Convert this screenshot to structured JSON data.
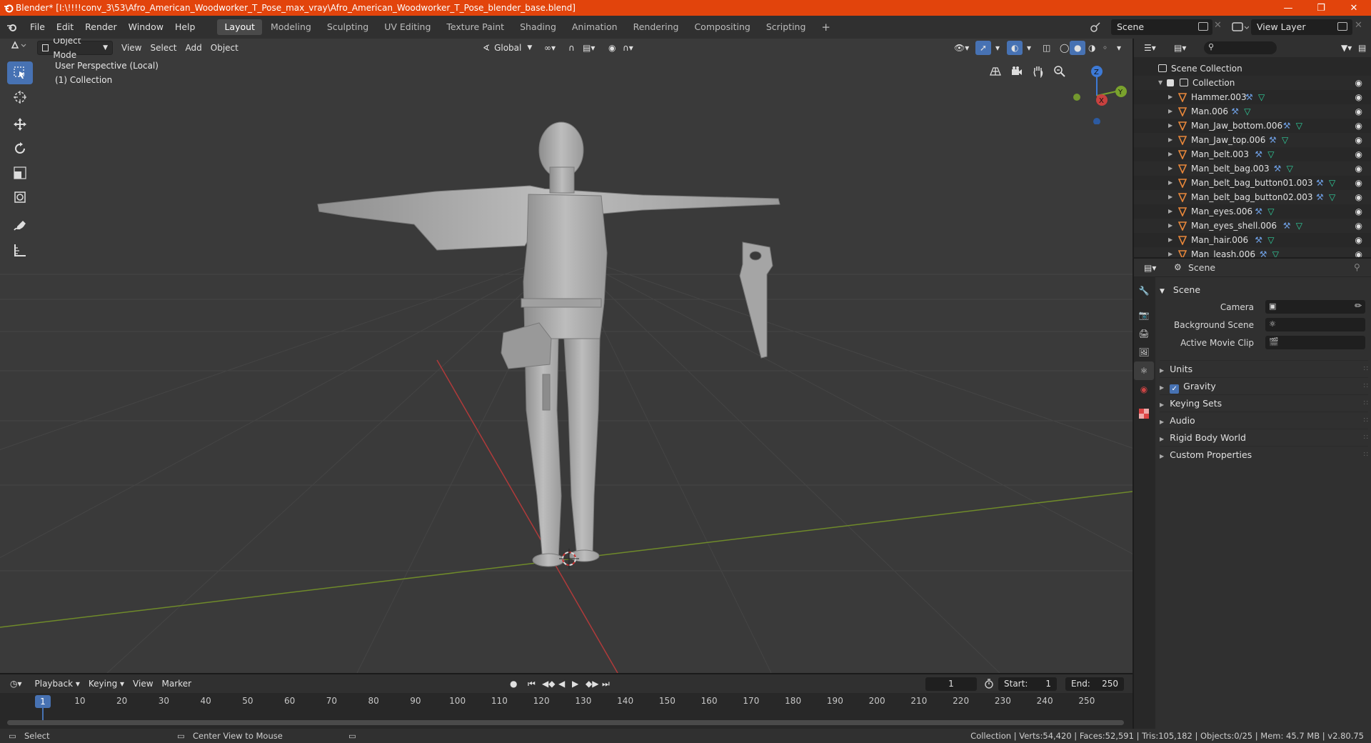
{
  "window": {
    "title": "Blender* [I:\\!!!!conv_3\\53\\Afro_American_Woodworker_T_Pose_max_vray\\Afro_American_Woodworker_T_Pose_blender_base.blend]",
    "controls": [
      "minimize",
      "maximize",
      "close"
    ]
  },
  "menu": {
    "items": [
      "File",
      "Edit",
      "Render",
      "Window",
      "Help"
    ]
  },
  "workspaces": [
    "Layout",
    "Modeling",
    "Sculpting",
    "UV Editing",
    "Texture Paint",
    "Shading",
    "Animation",
    "Rendering",
    "Compositing",
    "Scripting"
  ],
  "active_workspace": "Layout",
  "scene_selector": "Scene",
  "view_layer_selector": "View Layer",
  "viewport": {
    "mode": "Object Mode",
    "menus": [
      "View",
      "Select",
      "Add",
      "Object"
    ],
    "transform_orientation": "Global",
    "info_line1": "User Perspective (Local)",
    "info_line2": "(1) Collection",
    "gizmo": {
      "z": "Z",
      "y": "Y",
      "x": "X"
    }
  },
  "timeline": {
    "menus": [
      "Playback",
      "Keying",
      "View",
      "Marker"
    ],
    "current_frame": "1",
    "start_label": "Start:",
    "start": "1",
    "end_label": "End:",
    "end": "250",
    "ticks": [
      "10",
      "20",
      "30",
      "40",
      "50",
      "60",
      "70",
      "80",
      "90",
      "100",
      "110",
      "120",
      "130",
      "140",
      "150",
      "160",
      "170",
      "180",
      "190",
      "200",
      "210",
      "220",
      "230",
      "240",
      "250"
    ],
    "playhead": "1"
  },
  "outliner": {
    "root": "Scene Collection",
    "collection": "Collection",
    "objects": [
      {
        "name": "Hammer.003"
      },
      {
        "name": "Man.006"
      },
      {
        "name": "Man_Jaw_bottom.006"
      },
      {
        "name": "Man_Jaw_top.006"
      },
      {
        "name": "Man_belt.003"
      },
      {
        "name": "Man_belt_bag.003"
      },
      {
        "name": "Man_belt_bag_button01.003"
      },
      {
        "name": "Man_belt_bag_button02.003"
      },
      {
        "name": "Man_eyes.006"
      },
      {
        "name": "Man_eyes_shell.006"
      },
      {
        "name": "Man_hair.006"
      },
      {
        "name": "Man_leash.006"
      }
    ]
  },
  "properties": {
    "context": "Scene",
    "panel_title": "Scene",
    "camera_label": "Camera",
    "background_scene_label": "Background Scene",
    "active_movie_clip_label": "Active Movie Clip",
    "sections": [
      "Units",
      "Gravity",
      "Keying Sets",
      "Audio",
      "Rigid Body World",
      "Custom Properties"
    ],
    "gravity_checked": true
  },
  "statusbar": {
    "left_action": "Select",
    "mid_action": "Center View to Mouse",
    "stats": "Collection | Verts:54,420 | Faces:52,591 | Tris:105,182 | Objects:0/25 | Mem: 45.7 MB | v2.80.75"
  },
  "colors": {
    "titlebar": "#e2440c",
    "accent": "#4772b3",
    "mesh_icon": "#e8873a",
    "modifier_icon": "#6d9de0",
    "data_icon": "#2fd19d",
    "x_axis": "#c8413f",
    "y_axis": "#7aa32d",
    "z_axis": "#3d7ad6"
  }
}
